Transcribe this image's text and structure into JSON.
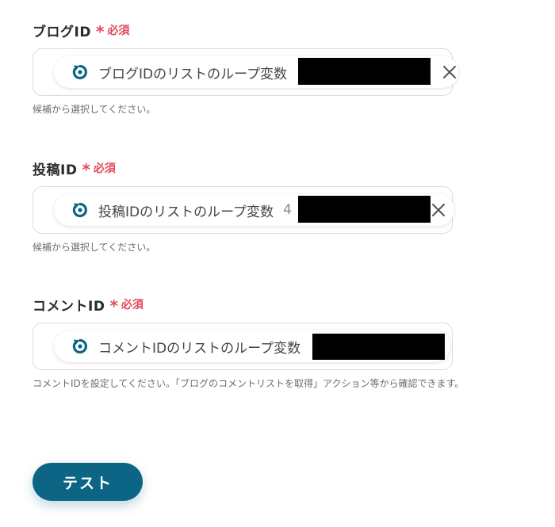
{
  "fields": [
    {
      "label": "ブログID",
      "required_mark": "*",
      "required_text": "必須",
      "chip_text": "ブログIDのリストのループ変数",
      "chip_suffix": "",
      "hint": "候補から選択してください。"
    },
    {
      "label": "投稿ID",
      "required_mark": "*",
      "required_text": "必須",
      "chip_text": "投稿IDのリストのループ変数",
      "chip_suffix": "4",
      "hint": "候補から選択してください。"
    },
    {
      "label": "コメントID",
      "required_mark": "*",
      "required_text": "必須",
      "chip_text": "コメントIDのリストのループ変数",
      "chip_suffix": "",
      "hint": "コメントIDを設定してください。「ブログのコメントリストを取得」アクション等から確認できます。"
    }
  ],
  "test_button_label": "テスト",
  "colors": {
    "required": "#e3495b",
    "primary": "#0c6584",
    "loop_icon": "#0c6584"
  },
  "icons": {
    "loop": "loop-variable-icon",
    "clear": "close-icon"
  }
}
